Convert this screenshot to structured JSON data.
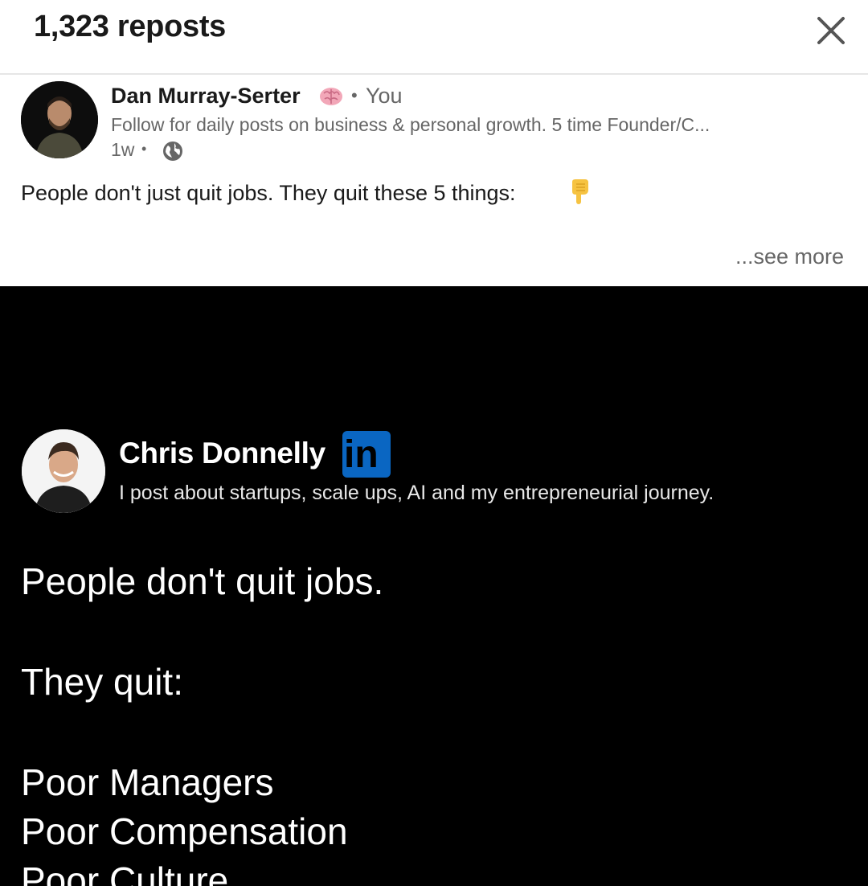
{
  "header": {
    "title": "1,323 reposts",
    "close_icon": "close-icon"
  },
  "post": {
    "author_name": "Dan Murray-Serter",
    "author_emoji_icon": "brain-icon",
    "relation": "You",
    "headline": "Follow for daily posts on business & personal growth. 5 time Founder/C...",
    "timestamp": "1w",
    "visibility_icon": "globe-icon",
    "text": "People don't just quit jobs. They quit these 5 things:",
    "text_emoji_icon": "pointing-down-icon",
    "see_more": "...see more"
  },
  "image": {
    "profile_name": "Chris Donnelly",
    "badge_text": "in",
    "tagline": "I post about startups, scale ups, AI and my entrepreneurial journey.",
    "lines": [
      "People don't quit jobs.",
      "They quit:",
      "Poor Managers",
      "Poor Compensation",
      "Poor Culture"
    ]
  },
  "colors": {
    "linkedin_blue": "#0a66c2",
    "image_background": "#000000",
    "muted_text": "#666666"
  }
}
